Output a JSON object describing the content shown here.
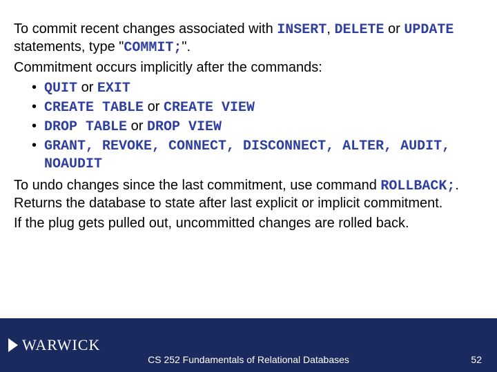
{
  "body": {
    "p1_a": "To commit recent changes associated with ",
    "p1_k1": "INSERT",
    "p1_sep1": ", ",
    "p1_k2": "DELETE",
    "p1_b": " or ",
    "p1_k3": "UPDATE",
    "p1_c": " statements, type \"",
    "p1_k4": "COMMIT;",
    "p1_d": "\".",
    "p2": "Commitment occurs implicitly after the commands:",
    "b1_k1": "QUIT",
    "b1_t1": " or ",
    "b1_k2": "EXIT",
    "b2_k1": "CREATE TABLE",
    "b2_t1": " or ",
    "b2_k2": "CREATE VIEW",
    "b3_k1": "DROP TABLE",
    "b3_t1": " or ",
    "b3_k2": "DROP VIEW",
    "b4_k": "GRANT, REVOKE, CONNECT, DISCONNECT, ALTER, AUDIT, NOAUDIT",
    "p3_a": "To undo changes since the last commitment, use command ",
    "p3_k": "ROLLBACK;",
    "p3_b": ". Returns the database to state after last explicit or implicit commitment.",
    "p4": "If the plug gets pulled out, uncommitted changes are rolled back."
  },
  "footer": {
    "logo": "WARWICK",
    "course": "CS 252 Fundamentals of Relational Databases",
    "page": "52"
  }
}
